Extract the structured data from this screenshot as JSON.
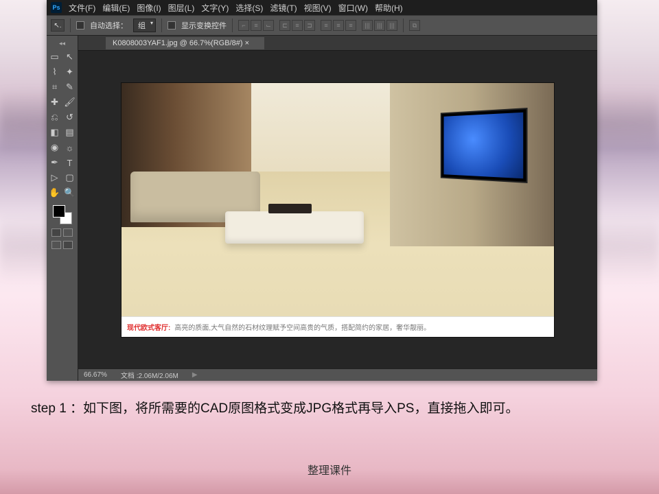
{
  "ps": {
    "logo": "Ps",
    "menu": [
      "文件(F)",
      "编辑(E)",
      "图像(I)",
      "图层(L)",
      "文字(Y)",
      "选择(S)",
      "滤镜(T)",
      "视图(V)",
      "窗口(W)",
      "帮助(H)"
    ],
    "options": {
      "auto_select_label": "自动选择：",
      "group_select": "组",
      "show_transform": "显示变换控件"
    },
    "tab": "K0808003YAF1.jpg @ 66.7%(RGB/8#) ×",
    "status": {
      "zoom": "66.67%",
      "docinfo": "文档 :2.06M/2.06M"
    },
    "image_caption": {
      "red": "现代欧式客厅:",
      "gray": "高亮的质面,大气自然的石材纹理赋予空间高贵的气质，搭配简约的家居，奢华靓丽。"
    }
  },
  "step": "step 1  ：如下图，将所需要的CAD原图格式变成JPG格式再导入PS，直接拖入即可。",
  "footer": "整理课件"
}
